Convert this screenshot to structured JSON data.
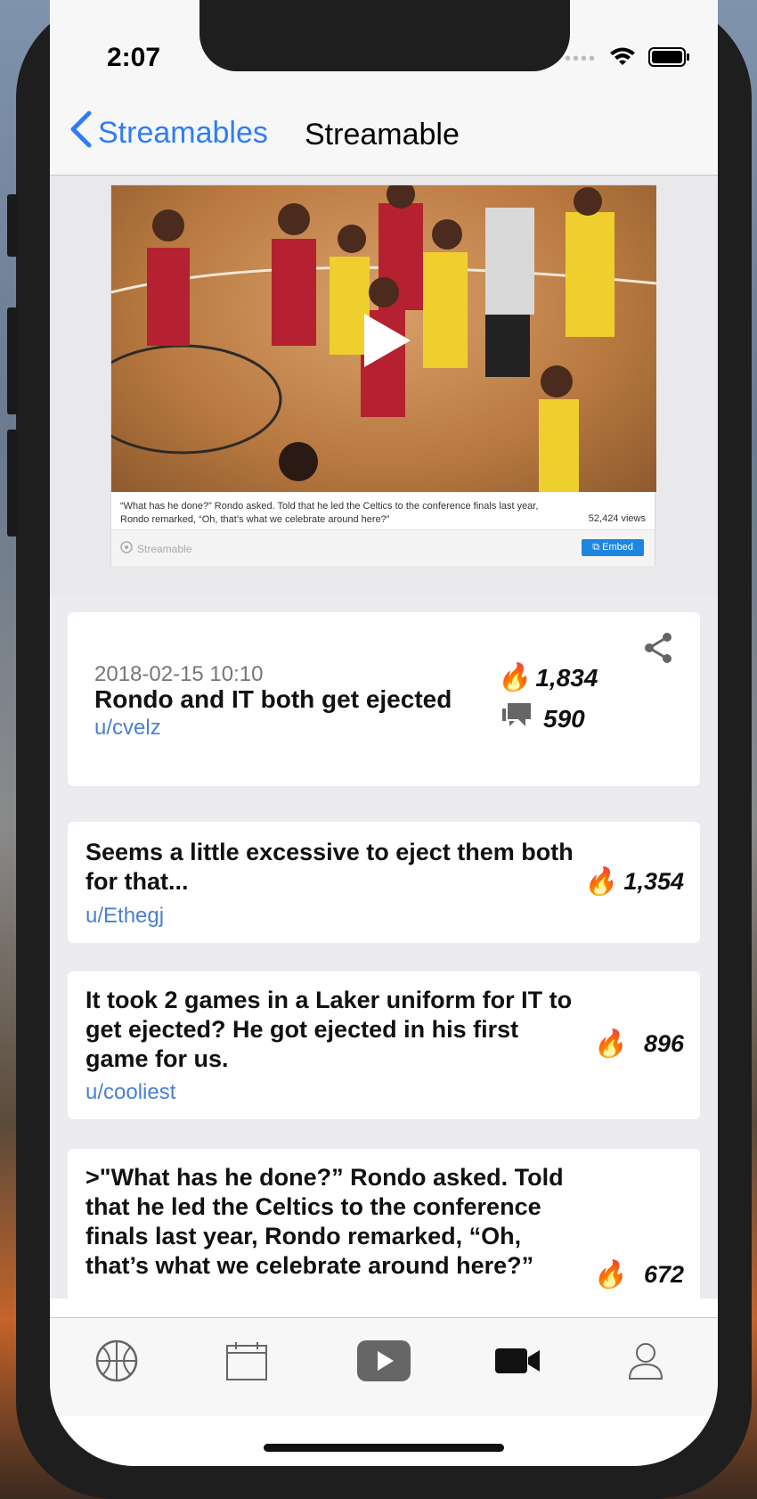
{
  "status": {
    "time": "2:07"
  },
  "nav": {
    "back_label": "Streamables",
    "title": "Streamable"
  },
  "embed": {
    "caption": "“What has he done?” Rondo asked. Told that he led the Celtics to the conference finals last year, Rondo remarked, “Oh, that’s what we celebrate around here?”",
    "views": "52,424 views",
    "brand": "Streamable",
    "embed_button": "Embed"
  },
  "post": {
    "date": "2018-02-15 10:10",
    "title": "Rondo and IT both get ejected",
    "user": "u/cvelz",
    "score": "1,834",
    "comments": "590"
  },
  "comments": [
    {
      "text": "Seems a little excessive to eject them both for that...",
      "user": "u/Ethegj",
      "score": "1,354"
    },
    {
      "text": "It took 2 games in a Laker uniform for IT to get ejected? He got ejected in his first game for us.",
      "user": "u/cooliest",
      "score": "896"
    },
    {
      "text": ">\"What has he done?” Rondo asked. Told that he led the Celtics to the conference finals last year, Rondo remarked, “Oh, that’s what we celebrate around here?”",
      "user": "",
      "score": "672"
    }
  ],
  "tabs": [
    "basketball-icon",
    "calendar-icon",
    "youtube-icon",
    "video-camera-icon",
    "profile-icon"
  ],
  "colors": {
    "accent": "#2f7cf6",
    "link": "#4a7fd4",
    "embed_button": "#1e86e0"
  }
}
